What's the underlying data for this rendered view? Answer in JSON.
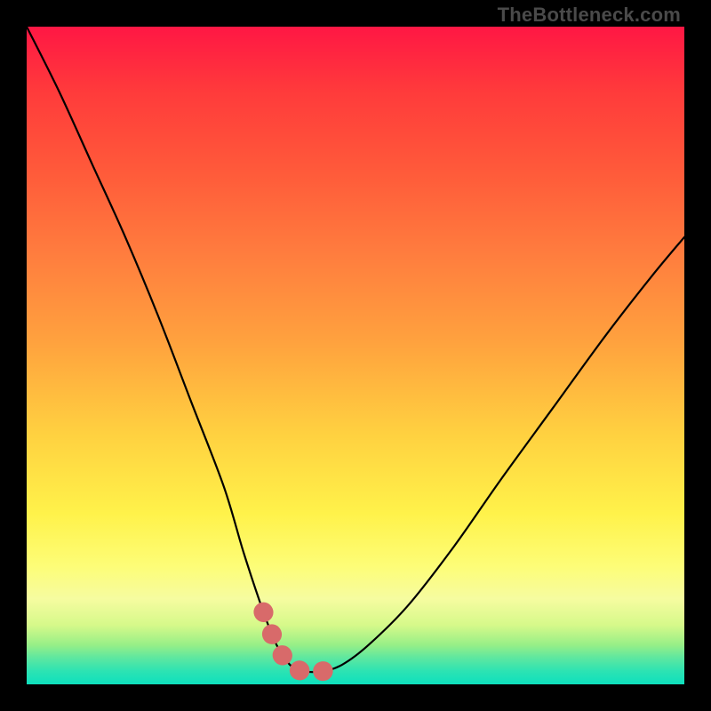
{
  "watermark": {
    "text": "TheBottleneck.com"
  },
  "chart_data": {
    "type": "line",
    "title": "",
    "xlabel": "",
    "ylabel": "",
    "xlim": [
      0,
      100
    ],
    "ylim": [
      0,
      100
    ],
    "grid": false,
    "legend": false,
    "series": [
      {
        "name": "bottleneck-curve",
        "x": [
          0,
          5,
          10,
          15,
          20,
          25,
          30,
          33,
          36,
          38,
          40,
          42,
          45,
          48,
          52,
          58,
          65,
          72,
          80,
          88,
          95,
          100
        ],
        "values": [
          100,
          90,
          79,
          68,
          56,
          43,
          30,
          20,
          11,
          6,
          3,
          2,
          2,
          3,
          6,
          12,
          21,
          31,
          42,
          53,
          62,
          68
        ]
      }
    ],
    "highlight_band": {
      "x_start": 36,
      "x_end": 48,
      "style": "thick-dotted",
      "color": "#d86a6a"
    },
    "background_gradient": {
      "direction": "top-to-bottom",
      "stops": [
        {
          "pos": 0.0,
          "color": "#ff1744"
        },
        {
          "pos": 0.35,
          "color": "#ff7e3e"
        },
        {
          "pos": 0.62,
          "color": "#ffd140"
        },
        {
          "pos": 0.82,
          "color": "#fdfd77"
        },
        {
          "pos": 0.94,
          "color": "#97ef87"
        },
        {
          "pos": 1.0,
          "color": "#0ee0bd"
        }
      ]
    }
  }
}
